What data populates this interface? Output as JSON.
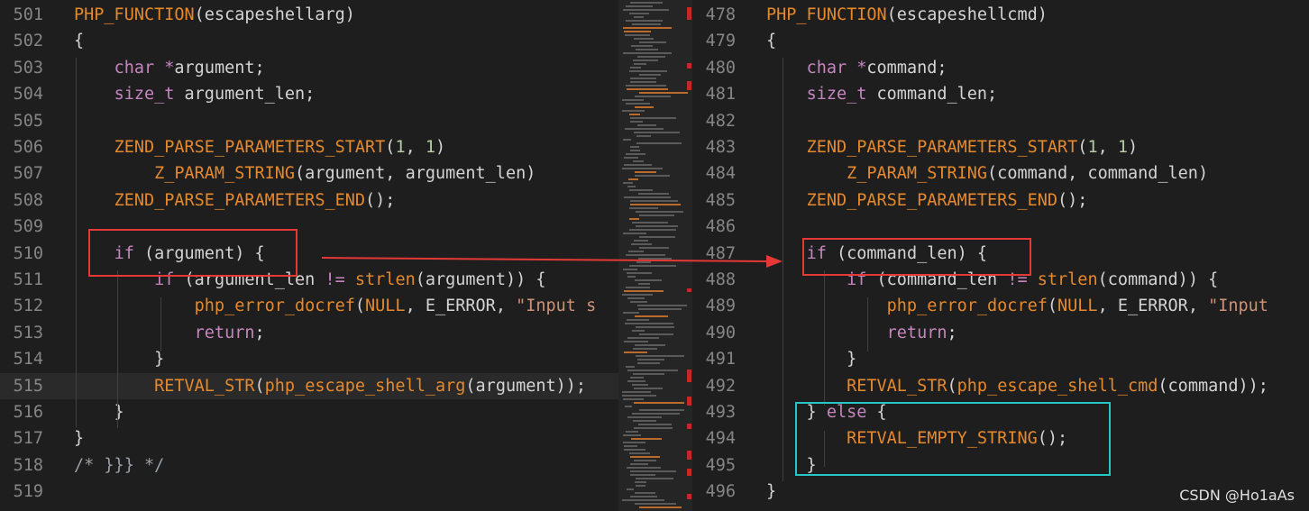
{
  "left": {
    "lines": [
      {
        "n": "501",
        "code": [
          [
            "mac",
            "PHP_FUNCTION"
          ],
          [
            "p",
            "(escapeshellarg)"
          ]
        ]
      },
      {
        "n": "502",
        "code": [
          [
            "p",
            "{"
          ]
        ]
      },
      {
        "n": "503",
        "code": [
          [
            "p",
            "    "
          ],
          [
            "ty",
            "char"
          ],
          [
            "p",
            " "
          ],
          [
            "op",
            "*"
          ],
          [
            "p",
            "argument;"
          ]
        ]
      },
      {
        "n": "504",
        "code": [
          [
            "p",
            "    "
          ],
          [
            "ty",
            "size_t"
          ],
          [
            "p",
            " argument_len;"
          ]
        ]
      },
      {
        "n": "505",
        "code": []
      },
      {
        "n": "506",
        "code": [
          [
            "p",
            "    "
          ],
          [
            "mac",
            "ZEND_PARSE_PARAMETERS_START"
          ],
          [
            "p",
            "("
          ],
          [
            "num",
            "1"
          ],
          [
            "p",
            ", "
          ],
          [
            "num",
            "1"
          ],
          [
            "p",
            ")"
          ]
        ]
      },
      {
        "n": "507",
        "code": [
          [
            "p",
            "        "
          ],
          [
            "mac",
            "Z_PARAM_STRING"
          ],
          [
            "p",
            "(argument, argument_len)"
          ]
        ]
      },
      {
        "n": "508",
        "code": [
          [
            "p",
            "    "
          ],
          [
            "mac",
            "ZEND_PARSE_PARAMETERS_END"
          ],
          [
            "p",
            "();"
          ]
        ]
      },
      {
        "n": "509",
        "code": []
      },
      {
        "n": "510",
        "code": [
          [
            "p",
            "    "
          ],
          [
            "kw",
            "if"
          ],
          [
            "p",
            " (argument) {"
          ]
        ]
      },
      {
        "n": "511",
        "code": [
          [
            "p",
            "        "
          ],
          [
            "kw",
            "if"
          ],
          [
            "p",
            " (argument_len "
          ],
          [
            "op",
            "!="
          ],
          [
            "p",
            " "
          ],
          [
            "fn",
            "strlen"
          ],
          [
            "p",
            "(argument)) {"
          ]
        ]
      },
      {
        "n": "512",
        "code": [
          [
            "p",
            "            "
          ],
          [
            "fn",
            "php_error_docref"
          ],
          [
            "p",
            "("
          ],
          [
            "mac",
            "NULL"
          ],
          [
            "p",
            ", E_ERROR, "
          ],
          [
            "str",
            "\"Input s"
          ]
        ]
      },
      {
        "n": "513",
        "code": [
          [
            "p",
            "            "
          ],
          [
            "kw",
            "return"
          ],
          [
            "p",
            ";"
          ]
        ]
      },
      {
        "n": "514",
        "code": [
          [
            "p",
            "        }"
          ]
        ]
      },
      {
        "n": "515",
        "code": [
          [
            "p",
            "        "
          ],
          [
            "mac",
            "RETVAL_STR"
          ],
          [
            "p",
            "("
          ],
          [
            "fn",
            "php_escape_shell_arg"
          ],
          [
            "p",
            "(argument));"
          ]
        ]
      },
      {
        "n": "516",
        "code": [
          [
            "p",
            "    }"
          ]
        ]
      },
      {
        "n": "517",
        "code": [
          [
            "p",
            "}"
          ]
        ]
      },
      {
        "n": "518",
        "code": [
          [
            "cm",
            "/* }}} */"
          ]
        ]
      },
      {
        "n": "519",
        "code": []
      }
    ]
  },
  "right": {
    "lines": [
      {
        "n": "478",
        "code": [
          [
            "mac",
            "PHP_FUNCTION"
          ],
          [
            "p",
            "(escapeshellcmd)"
          ]
        ]
      },
      {
        "n": "479",
        "code": [
          [
            "p",
            "{"
          ]
        ]
      },
      {
        "n": "480",
        "code": [
          [
            "p",
            "    "
          ],
          [
            "ty",
            "char"
          ],
          [
            "p",
            " "
          ],
          [
            "op",
            "*"
          ],
          [
            "p",
            "command;"
          ]
        ]
      },
      {
        "n": "481",
        "code": [
          [
            "p",
            "    "
          ],
          [
            "ty",
            "size_t"
          ],
          [
            "p",
            " command_len;"
          ]
        ]
      },
      {
        "n": "482",
        "code": []
      },
      {
        "n": "483",
        "code": [
          [
            "p",
            "    "
          ],
          [
            "mac",
            "ZEND_PARSE_PARAMETERS_START"
          ],
          [
            "p",
            "("
          ],
          [
            "num",
            "1"
          ],
          [
            "p",
            ", "
          ],
          [
            "num",
            "1"
          ],
          [
            "p",
            ")"
          ]
        ]
      },
      {
        "n": "484",
        "code": [
          [
            "p",
            "        "
          ],
          [
            "mac",
            "Z_PARAM_STRING"
          ],
          [
            "p",
            "(command, command_len)"
          ]
        ]
      },
      {
        "n": "485",
        "code": [
          [
            "p",
            "    "
          ],
          [
            "mac",
            "ZEND_PARSE_PARAMETERS_END"
          ],
          [
            "p",
            "();"
          ]
        ]
      },
      {
        "n": "486",
        "code": []
      },
      {
        "n": "487",
        "code": [
          [
            "p",
            "    "
          ],
          [
            "kw",
            "if"
          ],
          [
            "p",
            " (command_len) {"
          ]
        ]
      },
      {
        "n": "488",
        "code": [
          [
            "p",
            "        "
          ],
          [
            "kw",
            "if"
          ],
          [
            "p",
            " (command_len "
          ],
          [
            "op",
            "!="
          ],
          [
            "p",
            " "
          ],
          [
            "fn",
            "strlen"
          ],
          [
            "p",
            "(command)) {"
          ]
        ]
      },
      {
        "n": "489",
        "code": [
          [
            "p",
            "            "
          ],
          [
            "fn",
            "php_error_docref"
          ],
          [
            "p",
            "("
          ],
          [
            "mac",
            "NULL"
          ],
          [
            "p",
            ", E_ERROR, "
          ],
          [
            "str",
            "\"Input"
          ]
        ]
      },
      {
        "n": "490",
        "code": [
          [
            "p",
            "            "
          ],
          [
            "kw",
            "return"
          ],
          [
            "p",
            ";"
          ]
        ]
      },
      {
        "n": "491",
        "code": [
          [
            "p",
            "        }"
          ]
        ]
      },
      {
        "n": "492",
        "code": [
          [
            "p",
            "        "
          ],
          [
            "mac",
            "RETVAL_STR"
          ],
          [
            "p",
            "("
          ],
          [
            "fn",
            "php_escape_shell_cmd"
          ],
          [
            "p",
            "(command));"
          ]
        ]
      },
      {
        "n": "493",
        "code": [
          [
            "p",
            "    } "
          ],
          [
            "kw",
            "else"
          ],
          [
            "p",
            " {"
          ]
        ]
      },
      {
        "n": "494",
        "code": [
          [
            "p",
            "        "
          ],
          [
            "mac",
            "RETVAL_EMPTY_STRING"
          ],
          [
            "p",
            "();"
          ]
        ]
      },
      {
        "n": "495",
        "code": [
          [
            "p",
            "    }"
          ]
        ]
      },
      {
        "n": "496",
        "code": [
          [
            "p",
            "}"
          ]
        ]
      }
    ]
  },
  "watermark": "CSDN @Ho1aAs"
}
